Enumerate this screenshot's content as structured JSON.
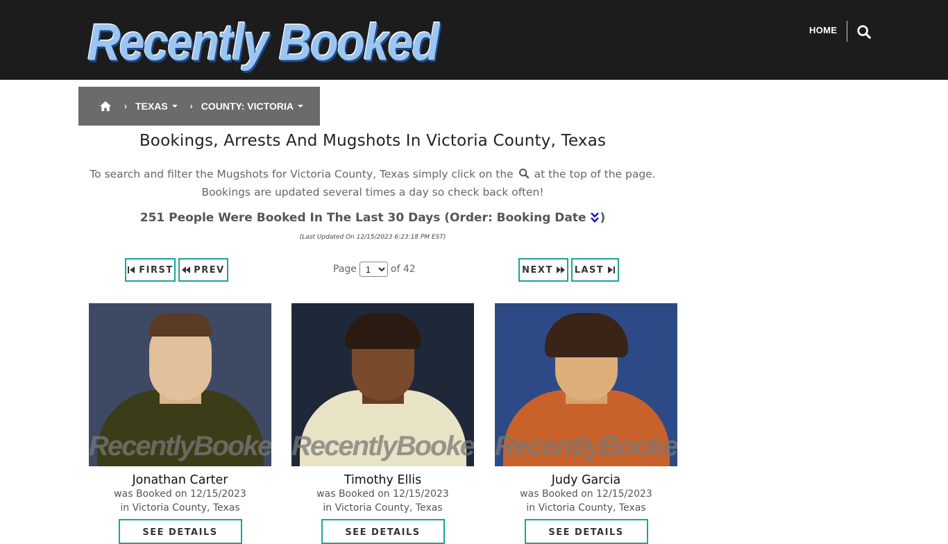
{
  "header": {
    "logo_text": "Recently Booked",
    "nav_home": "HOME",
    "search_icon": "search-icon"
  },
  "breadcrumb": {
    "home_icon": "home-icon",
    "state": "TEXAS",
    "county": "COUNTY: VICTORIA"
  },
  "main": {
    "title": "Bookings, Arrests And Mugshots In Victoria County, Texas",
    "intro_before": "To search and filter the Mugshots for Victoria County, Texas simply click on the",
    "intro_after": "at the top of the page. Bookings are updated several times a day so check back often!",
    "count_text": "251 People Were Booked In The Last 30 Days (Order: Booking Date",
    "count_close": ")",
    "last_updated": "(Last Updated On 12/15/2023 6:23:18 PM EST)"
  },
  "pager": {
    "first": "FIRST",
    "prev": "PREV",
    "next": "NEXT",
    "last": "LAST",
    "page_label": "Page",
    "current_page": "1",
    "of_label": "of 42"
  },
  "cards": [
    {
      "name": "Jonathan Carter",
      "booked": "was Booked on 12/15/2023 in Victoria County, Texas",
      "button": "SEE DETAILS",
      "watermark": "RecentlyBooked.com"
    },
    {
      "name": "Timothy Ellis",
      "booked": "was Booked on 12/15/2023 in Victoria County, Texas",
      "button": "SEE DETAILS",
      "watermark": "RecentlyBooked.com"
    },
    {
      "name": "Judy Garcia",
      "booked": "was Booked on 12/15/2023 in Victoria County, Texas",
      "button": "SEE DETAILS",
      "watermark": "RecentlyBooked.com"
    }
  ],
  "colors": {
    "header_bg": "#1c1c1c",
    "breadcrumb_bg": "#6b6b6b",
    "accent_border": "#1aa39a",
    "order_icon": "#1a1acc"
  }
}
